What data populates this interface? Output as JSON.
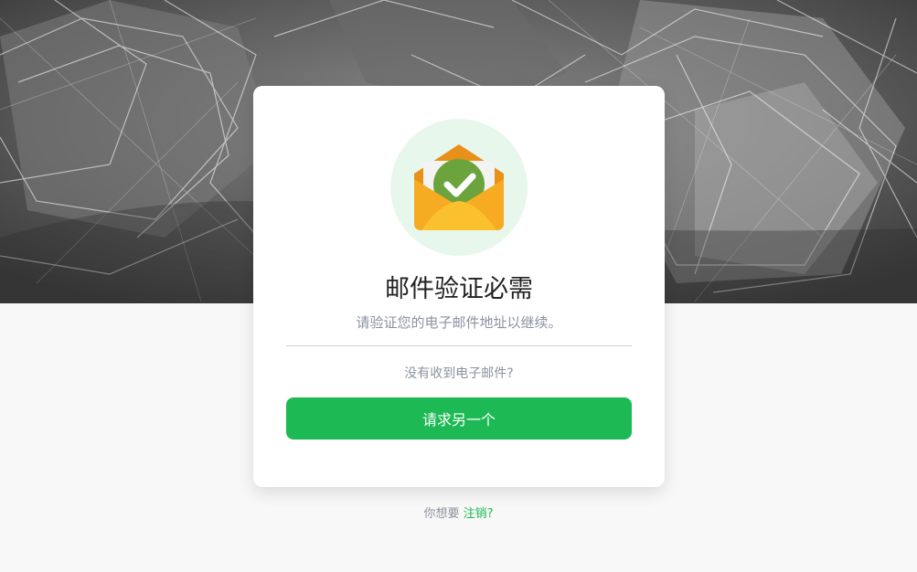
{
  "hero": {
    "icon": "abstract-geometric-background"
  },
  "card": {
    "icon": "envelope-check-icon",
    "title": "邮件验证必需",
    "subtitle": "请验证您的电子邮件地址以继续。",
    "question": "没有收到电子邮件?",
    "button_label": "请求另一个"
  },
  "footer": {
    "prompt": "你想要",
    "link_label": "注销?"
  },
  "colors": {
    "accent": "#1db954",
    "page_bg": "#f8f8f8",
    "icon_circle": "#e8f7ec"
  }
}
